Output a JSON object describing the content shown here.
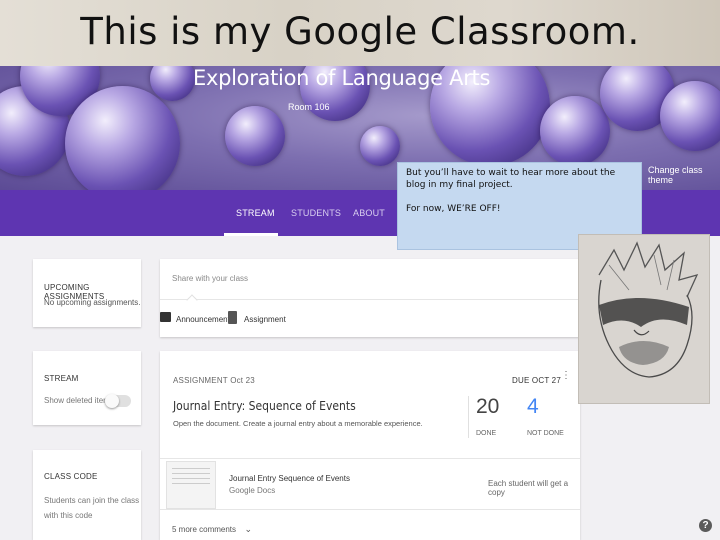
{
  "slide": {
    "title": "This is my Google Classroom."
  },
  "banner": {
    "course_title": "Exploration of Language Arts",
    "room": "Room 106",
    "change_theme": "Change class theme"
  },
  "tabs": [
    {
      "label": "STREAM",
      "active": true
    },
    {
      "label": "STUDENTS",
      "active": false
    },
    {
      "label": "ABOUT",
      "active": false
    }
  ],
  "upcoming": {
    "title": "UPCOMING ASSIGNMENTS",
    "text": "No upcoming assignments."
  },
  "stream_settings": {
    "title": "STREAM",
    "toggle_label": "Show deleted items"
  },
  "class_code": {
    "title": "CLASS CODE",
    "line1": "Students can join the class",
    "line2": "with this code"
  },
  "share": {
    "placeholder": "Share with your class",
    "announcement_label": "Announcement",
    "assignment_label": "Assignment"
  },
  "assignment": {
    "kind": "ASSIGNMENT",
    "date": "Oct 23",
    "due": "DUE OCT 27",
    "title": "Journal Entry: Sequence of Events",
    "description": "Open the document. Create a journal entry about a memorable experience.",
    "done_count": "20",
    "done_label": "DONE",
    "not_done_count": "4",
    "not_done_label": "NOT DONE",
    "attachment_title": "Journal Entry Sequence of Events",
    "attachment_type": "Google Docs",
    "attachment_note": "Each student will get a copy",
    "comments": "5 more comments"
  },
  "note": {
    "line1": "But you’ll have to wait to hear more about the blog in my final project.",
    "line2": "For now, WE’RE OFF!"
  },
  "colors": {
    "tab_bar": "#5e35b1",
    "note_bg": "#c5d9f0",
    "progress_line": "#4285f4"
  },
  "icons": [
    "announcement-icon",
    "assignment-icon",
    "more-vert-icon",
    "chevron-down-icon",
    "help-icon"
  ]
}
